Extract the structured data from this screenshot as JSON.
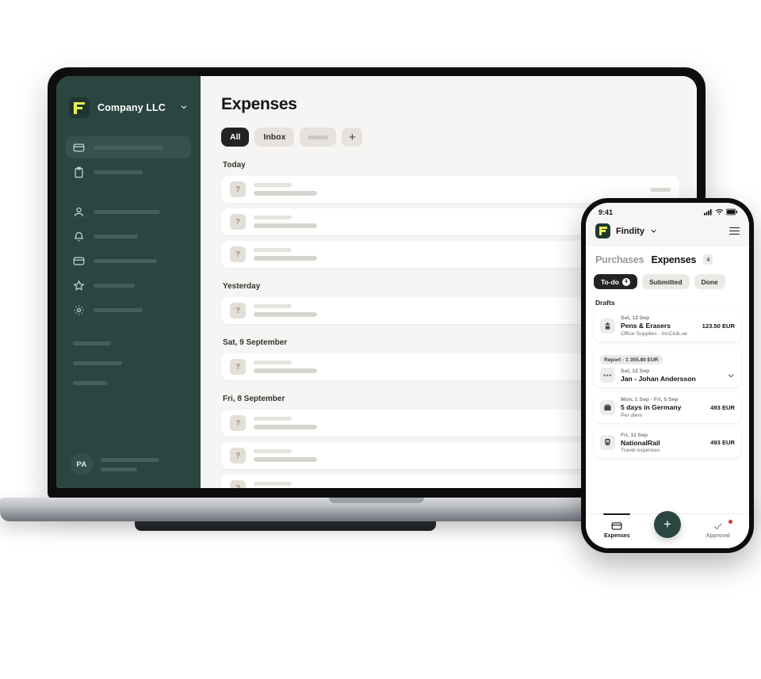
{
  "desktop": {
    "sidebar": {
      "brand": {
        "name": "Company LLC",
        "logo_icon": "findity-logo",
        "chevron_icon": "chevron-down-icon"
      },
      "items": [
        {
          "icon": "credit-card-icon",
          "active": true,
          "skeleton_width": 88
        },
        {
          "icon": "clipboard-icon",
          "active": false,
          "skeleton_width": 62
        },
        {
          "icon": "person-icon",
          "active": false,
          "skeleton_width": 84
        },
        {
          "icon": "bell-icon",
          "active": false,
          "skeleton_width": 56
        },
        {
          "icon": "credit-card-icon",
          "active": false,
          "skeleton_width": 80
        },
        {
          "icon": "star-icon",
          "active": false,
          "skeleton_width": 52
        },
        {
          "icon": "gear-icon",
          "active": false,
          "skeleton_width": 62
        }
      ],
      "footer_skeletons": [
        48,
        62,
        44
      ],
      "profile": {
        "initials": "PA",
        "line_widths": [
          74,
          46
        ]
      }
    },
    "main": {
      "title": "Expenses",
      "chips": [
        {
          "label": "All",
          "active": true
        },
        {
          "label": "Inbox",
          "active": false
        },
        {
          "label": "",
          "active": false,
          "blank": true
        },
        {
          "label": "+",
          "active": false,
          "plus": true
        }
      ],
      "sections": [
        {
          "label": "Today",
          "rows": [
            {
              "icon": "question-placeholder",
              "has_right_bar": true
            },
            {
              "icon": "question-placeholder",
              "has_right_bar": false
            },
            {
              "icon": "question-placeholder",
              "has_right_bar": false
            }
          ]
        },
        {
          "label": "Yesterday",
          "rows": [
            {
              "icon": "question-placeholder",
              "has_right_bar": false
            }
          ]
        },
        {
          "label": "Sat, 9 September",
          "rows": [
            {
              "icon": "question-placeholder",
              "has_right_bar": false
            }
          ]
        },
        {
          "label": "Fri, 8 September",
          "rows": [
            {
              "icon": "question-placeholder",
              "has_right_bar": false
            },
            {
              "icon": "question-placeholder",
              "has_right_bar": false
            },
            {
              "icon": "question-placeholder",
              "has_right_bar": false
            }
          ]
        }
      ],
      "row_placeholder_glyph": "?"
    }
  },
  "phone": {
    "status": {
      "time": "9:41",
      "signal_icon": "cellular-signal-icon",
      "wifi_icon": "wifi-icon",
      "battery_icon": "battery-icon"
    },
    "header": {
      "brand": "Findity",
      "logo_icon": "findity-logo",
      "chevron_icon": "chevron-down-icon",
      "menu_icon": "hamburger-menu-icon"
    },
    "tabs": [
      {
        "label": "Purchases",
        "active": false,
        "count": ""
      },
      {
        "label": "Expenses",
        "active": true,
        "count": "4"
      }
    ],
    "segments": [
      {
        "label": "To-do",
        "active": true,
        "badge": "4"
      },
      {
        "label": "Submitted",
        "active": false,
        "badge": ""
      },
      {
        "label": "Done",
        "active": false,
        "badge": ""
      }
    ],
    "section_label": "Drafts",
    "items": [
      {
        "type": "expense",
        "icon": "office-supplies-icon",
        "date": "Sat, 12 Sep",
        "title": "Pens & Erasers",
        "subtitle": "Office Supplies · IncClub.se",
        "amount": "123.50 EUR"
      },
      {
        "type": "report",
        "badge": "Report · 1 355.80 EUR",
        "icon": "ellipsis-icon",
        "date": "Sat, 12 Sep",
        "title": "Jan - Johan Andersson",
        "subtitle": "",
        "amount": "",
        "chevron_icon": "chevron-down-icon"
      },
      {
        "type": "expense",
        "icon": "per-diem-icon",
        "date": "Mon, 1 Sep - Fri, 5 Sep",
        "title": "5 days in Germany",
        "subtitle": "Per diem",
        "amount": "493 EUR"
      },
      {
        "type": "expense",
        "icon": "train-icon",
        "date": "Fri, 11 Sep",
        "title": "NationalRail",
        "subtitle": "Travel expenses",
        "amount": "493 EUR"
      }
    ],
    "tabbar": {
      "expenses": {
        "label": "Expenses",
        "icon": "credit-card-icon",
        "active": true
      },
      "add": {
        "label": "+",
        "icon": "plus-icon"
      },
      "approval": {
        "label": "Approval",
        "icon": "check-icon",
        "active": false,
        "has_notification_dot": true
      }
    }
  },
  "colors": {
    "sidebar_bg": "#2b4540",
    "accent_yellow": "#e8f34a",
    "canvas": "#f6f5f3",
    "chip_active": "#232323",
    "notification_red": "#d23b2b"
  }
}
